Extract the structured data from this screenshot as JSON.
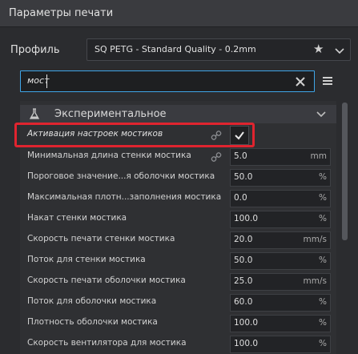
{
  "window": {
    "title": "Параметры печати"
  },
  "profile": {
    "label": "Профиль",
    "value": "SQ PETG - Standard Quality - 0.2mm"
  },
  "search": {
    "value": "мост"
  },
  "section": {
    "label": "Экспериментальное"
  },
  "rows": [
    {
      "label": "Активация настроек мостиков",
      "type": "checkbox",
      "checked": true,
      "linked": true
    },
    {
      "label": "Минимальная длина стенки мостика",
      "value": "5.0",
      "unit": "mm",
      "linked": true
    },
    {
      "label": "Пороговое значение...я оболочки мостика",
      "value": "50.0",
      "unit": "%"
    },
    {
      "label": "Максимальная плотн...заполнения мостика",
      "value": "0.0",
      "unit": "%"
    },
    {
      "label": "Накат стенки мостика",
      "value": "100.0",
      "unit": "%"
    },
    {
      "label": "Скорость печати стенки мостика",
      "value": "20.0",
      "unit": "mm/s"
    },
    {
      "label": "Поток для стенки мостика",
      "value": "50.0",
      "unit": "%"
    },
    {
      "label": "Скорость печати оболочки мостика",
      "value": "25.0",
      "unit": "mm/s"
    },
    {
      "label": "Поток для оболочки мостика",
      "value": "60.0",
      "unit": "%"
    },
    {
      "label": "Плотность оболочки мостика",
      "value": "100.0",
      "unit": "%"
    },
    {
      "label": "Скорость вентилятора для мостика",
      "value": "100.0",
      "unit": "%"
    }
  ],
  "colors": {
    "accent": "#3fa6e8",
    "highlight": "#e0242f"
  },
  "icons": {
    "favorite": "star-icon",
    "dropdown": "chevron-down-icon",
    "clear": "close-icon",
    "menu": "hamburger-menu-icon",
    "section": "flask-icon",
    "link": "link-icon",
    "check": "checkmark-icon"
  }
}
